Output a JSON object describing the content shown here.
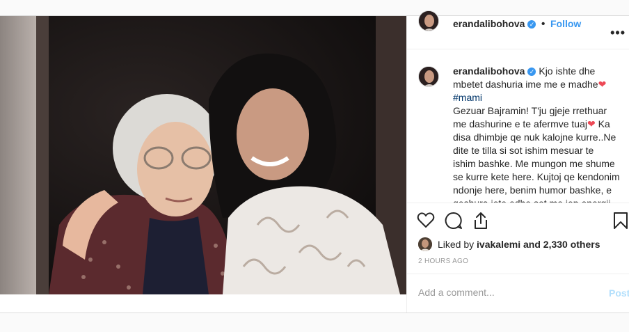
{
  "post": {
    "username": "erandalibohova",
    "follow_label": "Follow",
    "more_label": "•••",
    "verified_mark": "✓",
    "caption": {
      "line1": "Kjo ishte dhe",
      "line2": "mbetet dashuria ime me e madhe",
      "hashtag": "#mami",
      "body1": "Gezuar Bajramin! T'ju gjeje rrethuar",
      "body2": "me dashurine e te afermve tuaj",
      "body3": " Ka",
      "body4": "disa dhimbje qe nuk kalojne kurre..Ne",
      "body5": "dite te tilla si sot ishim mesuar te",
      "body6": "ishim bashke. Me mungon me shume",
      "body7": "se kurre kete here. Kujtoj qe kendonim",
      "body8": "ndonje here, benim humor bashke, e",
      "body9": "qeshura jote edhe sot me jep energji",
      "heart": "❤"
    },
    "likes": {
      "prefix": "Liked by ",
      "liker": "ivakalemi",
      "suffix": " and 2,330 others"
    },
    "timestamp": "2 HOURS AGO",
    "comment": {
      "placeholder": "Add a comment...",
      "post_label": "Post"
    }
  },
  "icons": {
    "like": "heart-outline-icon",
    "comment": "speech-bubble-icon",
    "share": "share-icon",
    "save": "bookmark-icon"
  },
  "colors": {
    "accent": "#3897f0",
    "heart": "#ed4956",
    "hashtag": "#003569"
  }
}
